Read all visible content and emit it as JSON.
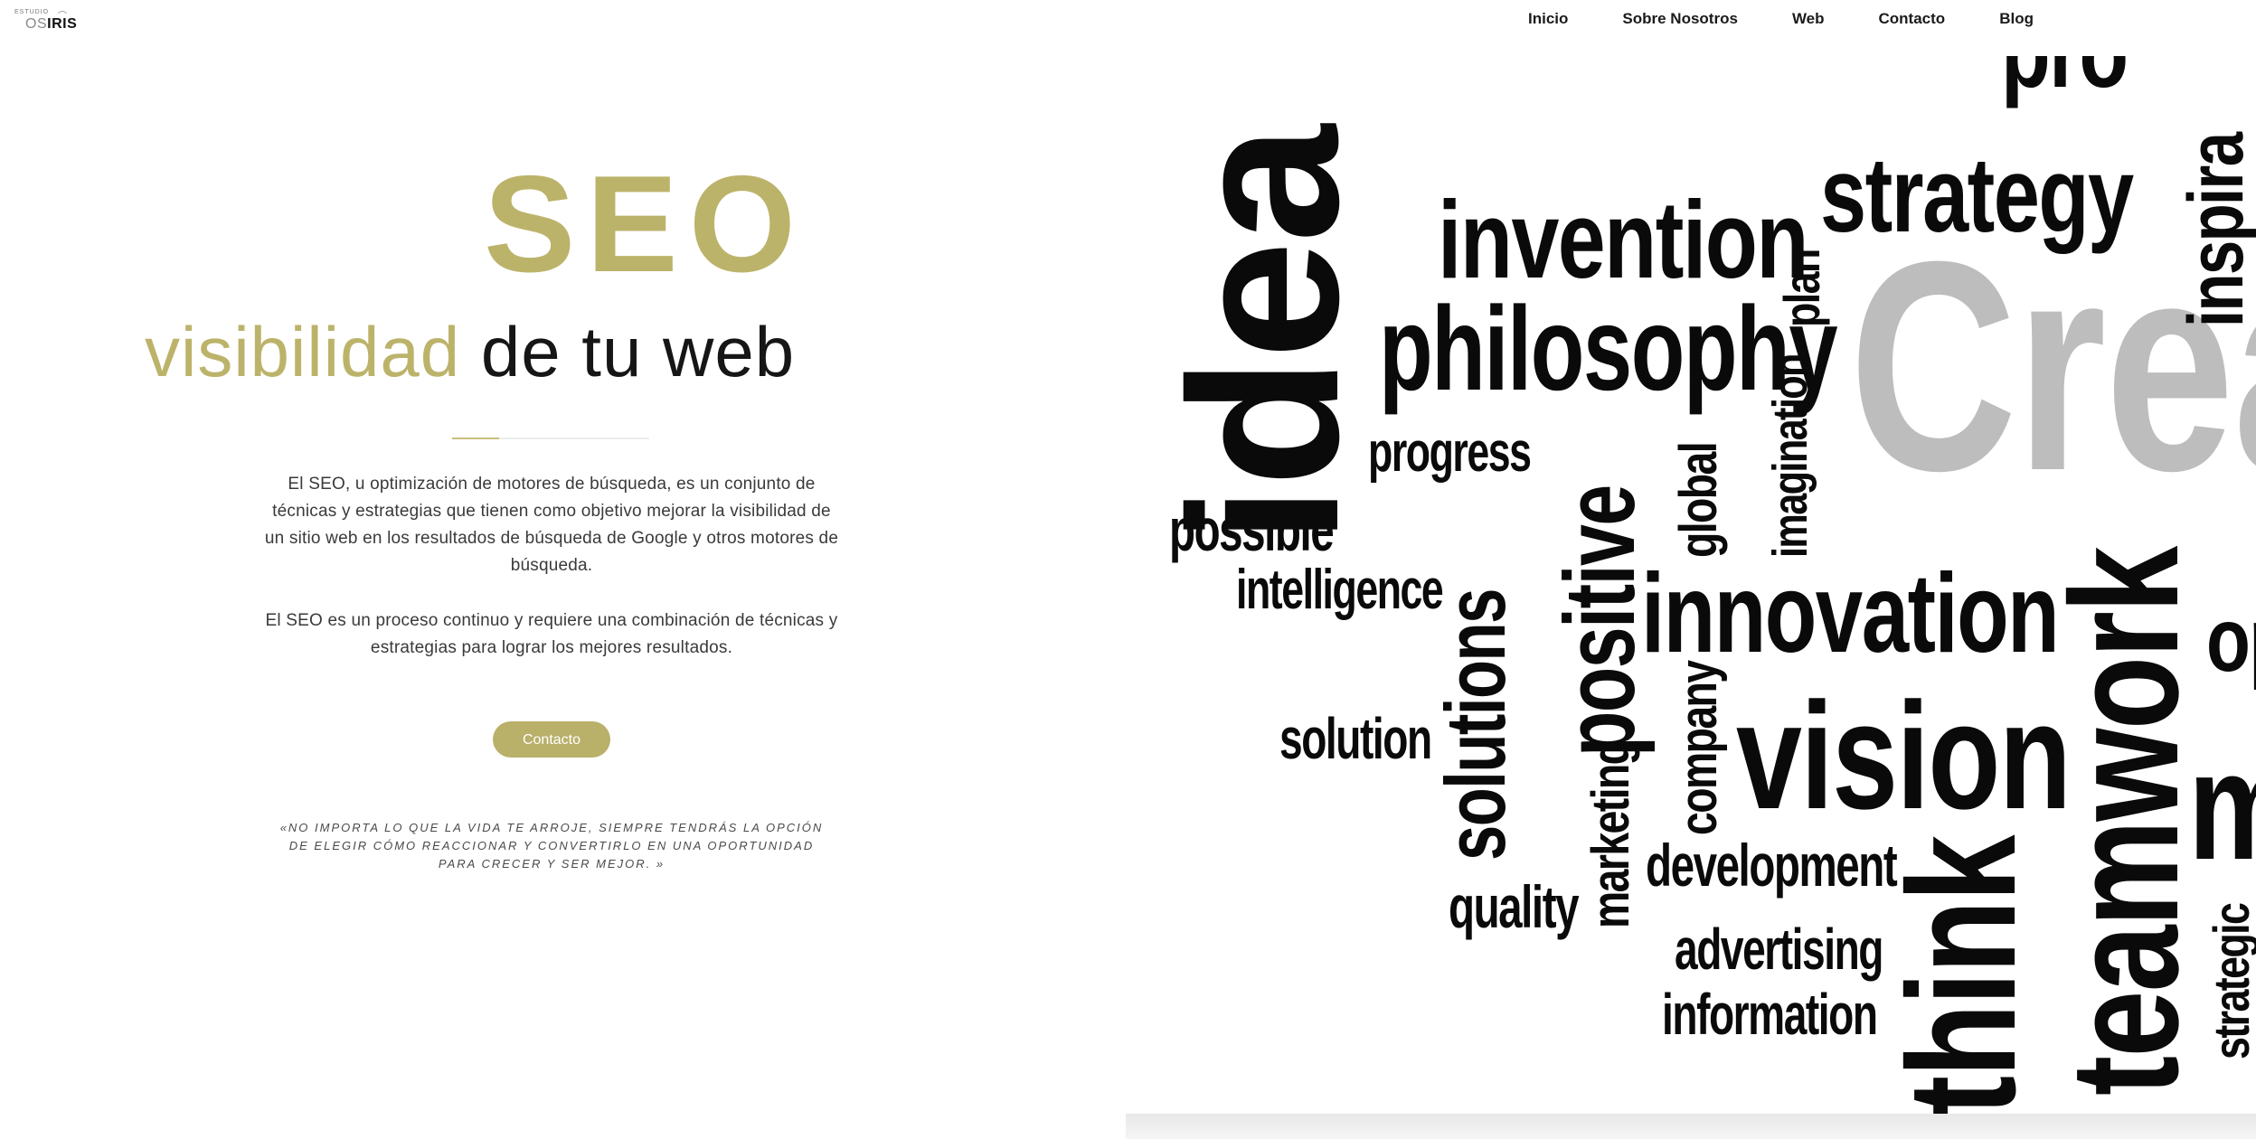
{
  "header": {
    "logo": {
      "small": "ESTUDIO",
      "os": "OS",
      "iris": "IRIS"
    },
    "nav": [
      "Inicio",
      "Sobre Nosotros",
      "Web",
      "Contacto",
      "Blog"
    ]
  },
  "hero": {
    "title": "SEO",
    "subtitle_gold": "visibilidad",
    "subtitle_dark": " de tu web",
    "paragraph1": "El SEO, u optimización de motores de búsqueda, es un conjunto de técnicas y estrategias que tienen como objetivo mejorar la visibilidad de un sitio web en los resultados de búsqueda de Google y otros motores de búsqueda.",
    "paragraph2": "El SEO es un proceso continuo y requiere una combinación de técnicas y estrategias para lograr los mejores resultados.",
    "cta_label": "Contacto",
    "quote": "«No importa lo que la vida te arroje, siempre tendrás la opción de elegir cómo reaccionar y convertirlo en una oportunidad para crecer y ser mejor. »"
  },
  "wordcloud": {
    "words": [
      "idea",
      "invention",
      "philosophy",
      "strategy",
      "plan",
      "progress",
      "imagination",
      "Crea",
      "inspira",
      "pro",
      "possible",
      "intelligence",
      "solutions",
      "positive",
      "global",
      "innovation",
      "teamwork",
      "op",
      "solution",
      "vision",
      "company",
      "marketing",
      "development",
      "quality",
      "think",
      "advertising",
      "information",
      "strategic",
      "m"
    ]
  },
  "colors": {
    "accent": "#bcb36a",
    "text": "#2b2b2b"
  }
}
